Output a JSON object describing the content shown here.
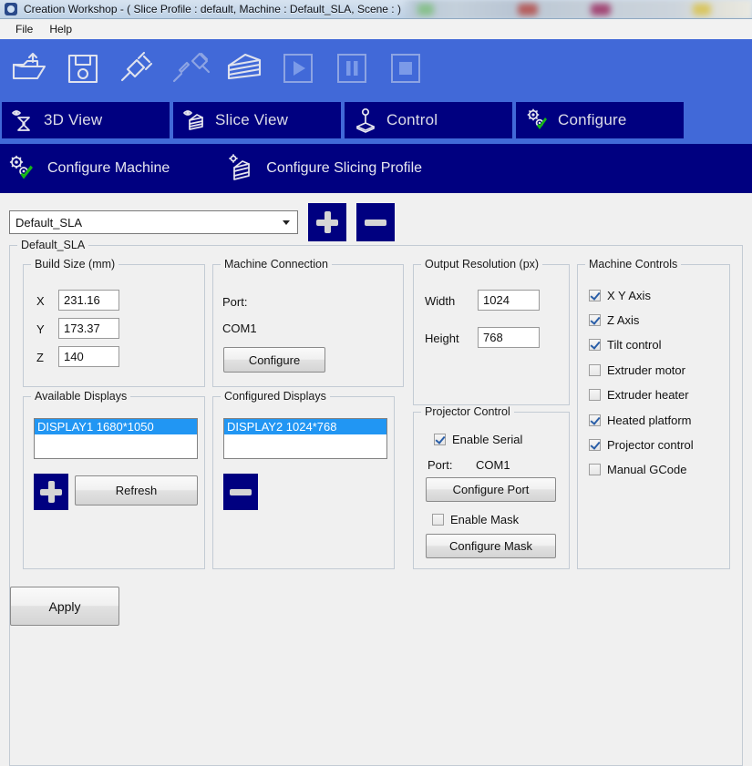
{
  "window": {
    "icon": "app-gear-icon",
    "title": "Creation Workshop -   ( Slice Profile : default, Machine : Default_SLA, Scene : )"
  },
  "menubar": {
    "items": [
      {
        "label": "File"
      },
      {
        "label": "Help"
      }
    ]
  },
  "toolbar": {
    "buttons": [
      {
        "name": "open-file-button",
        "icon": "open-folder-icon",
        "enabled": true
      },
      {
        "name": "save-file-button",
        "icon": "floppy-save-icon",
        "enabled": true
      },
      {
        "name": "connect-button",
        "icon": "plug-connect-icon",
        "enabled": true
      },
      {
        "name": "disconnect-button",
        "icon": "plug-disconnect-icon",
        "enabled": false
      },
      {
        "name": "slice-button",
        "icon": "sliced-layers-icon",
        "enabled": true
      },
      {
        "name": "print-play-button",
        "icon": "play-icon",
        "enabled": false
      },
      {
        "name": "print-pause-button",
        "icon": "pause-icon",
        "enabled": false
      },
      {
        "name": "print-stop-button",
        "icon": "stop-icon",
        "enabled": false
      }
    ]
  },
  "tabs": [
    {
      "label": "3D View",
      "icon": "eye-hourglass-icon",
      "active": false
    },
    {
      "label": "Slice View",
      "icon": "eye-layers-icon",
      "active": false
    },
    {
      "label": "Control",
      "icon": "joystick-icon",
      "active": false
    },
    {
      "label": "Configure",
      "icon": "gears-check-icon",
      "active": true
    }
  ],
  "subtabs": [
    {
      "label": "Configure Machine",
      "icon": "gears-check-icon",
      "active": true
    },
    {
      "label": "Configure Slicing Profile",
      "icon": "layers-gear-icon",
      "active": false
    }
  ],
  "profile": {
    "selected": "Default_SLA",
    "add_button": "add-profile-button",
    "remove_button": "remove-profile-button"
  },
  "machine": {
    "group_title": "Default_SLA",
    "build_size": {
      "title": "Build Size (mm)",
      "fields": [
        {
          "label": "X",
          "value": "231.16"
        },
        {
          "label": "Y",
          "value": "173.37"
        },
        {
          "label": "Z",
          "value": "140"
        }
      ]
    },
    "connection": {
      "title": "Machine Connection",
      "port_label": "Port:",
      "port_value": "COM1",
      "configure_label": "Configure"
    },
    "resolution": {
      "title": "Output Resolution (px)",
      "width_label": "Width",
      "width_value": "1024",
      "height_label": "Height",
      "height_value": "768"
    },
    "controls": {
      "title": "Machine Controls",
      "items": [
        {
          "label": "X Y Axis",
          "checked": true
        },
        {
          "label": "Z Axis",
          "checked": true
        },
        {
          "label": "Tilt control",
          "checked": true
        },
        {
          "label": "Extruder motor",
          "checked": false
        },
        {
          "label": "Extruder heater",
          "checked": false
        },
        {
          "label": "Heated platform",
          "checked": true
        },
        {
          "label": "Projector control",
          "checked": true
        },
        {
          "label": "Manual GCode",
          "checked": false
        }
      ]
    },
    "available_displays": {
      "title": "Available Displays",
      "items": [
        {
          "label": "DISPLAY1 1680*1050",
          "selected": true
        }
      ],
      "refresh_label": "Refresh",
      "add_button": "add-display-button"
    },
    "configured_displays": {
      "title": "Configured Displays",
      "items": [
        {
          "label": "DISPLAY2 1024*768",
          "selected": true
        }
      ],
      "remove_button": "remove-display-button"
    },
    "projector": {
      "title": "Projector Control",
      "enable_serial_label": "Enable Serial",
      "enable_serial_checked": true,
      "port_label": "Port:",
      "port_value": "COM1",
      "configure_port_label": "Configure Port",
      "enable_mask_label": "Enable Mask",
      "enable_mask_checked": false,
      "configure_mask_label": "Configure Mask"
    }
  },
  "apply_button": {
    "label": "Apply"
  },
  "colors": {
    "toolbar_blue": "#4169d8",
    "tab_navy": "#000080",
    "selection_blue": "#2196f3",
    "check_green": "#16b616",
    "panel_gray": "#f0f0f0"
  }
}
